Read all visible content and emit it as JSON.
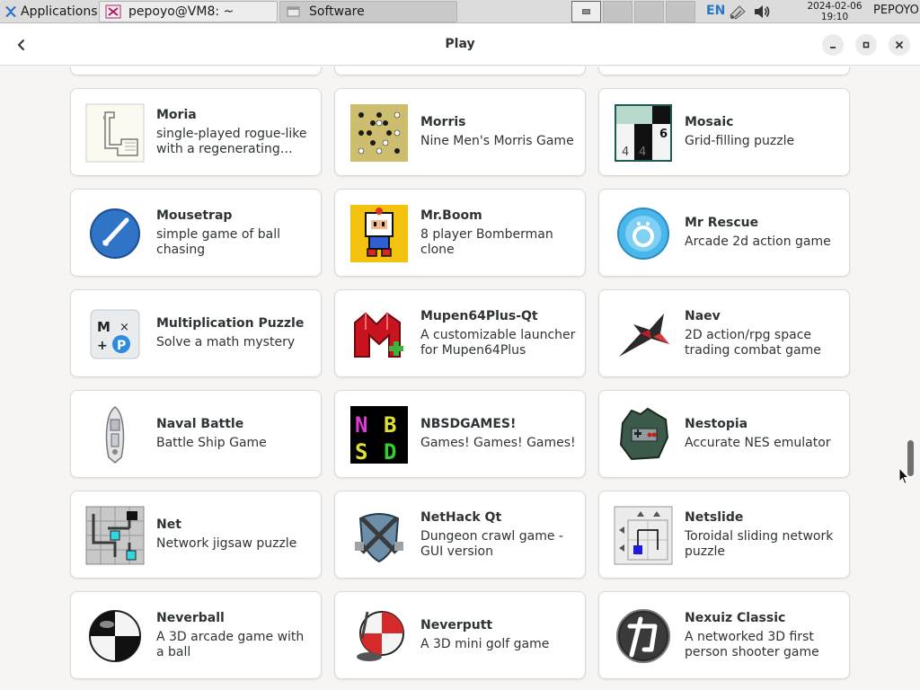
{
  "taskbar": {
    "apps_menu_label": "Applications",
    "tasks": [
      {
        "label": "pepoyo@VM8: ~"
      },
      {
        "label": "Software"
      }
    ],
    "language": "EN",
    "clock_date": "2024-02-06",
    "clock_time": "19:10",
    "user": "PEPOYO"
  },
  "header": {
    "title": "Play"
  },
  "apps": [
    {
      "name": "Moria",
      "description": "single-played rogue-like with a regenerating dungeon",
      "icon": "moria-map-icon"
    },
    {
      "name": "Morris",
      "description": "Nine Men's Morris Game",
      "icon": "morris-board-icon"
    },
    {
      "name": "Mosaic",
      "description": "Grid-filling puzzle",
      "icon": "mosaic-grid-icon"
    },
    {
      "name": "Mousetrap",
      "description": "simple game of ball chasing",
      "icon": "mousetrap-icon"
    },
    {
      "name": "Mr.Boom",
      "description": "8 player Bomberman clone",
      "icon": "mrboom-icon"
    },
    {
      "name": "Mr Rescue",
      "description": "Arcade 2d action game",
      "icon": "mr-rescue-icon"
    },
    {
      "name": "Multiplication Puzzle",
      "description": "Solve a math mystery",
      "icon": "multiplication-puzzle-icon"
    },
    {
      "name": "Mupen64Plus-Qt",
      "description": "A customizable launcher for Mupen64Plus",
      "icon": "mupen64plus-icon"
    },
    {
      "name": "Naev",
      "description": "2D action/rpg space trading combat game",
      "icon": "naev-ship-icon"
    },
    {
      "name": "Naval Battle",
      "description": "Battle Ship Game",
      "icon": "naval-battle-ship-icon"
    },
    {
      "name": "NBSDGAMES!",
      "description": "Games! Games! Games!",
      "icon": "nbsdgames-icon"
    },
    {
      "name": "Nestopia",
      "description": "Accurate NES emulator",
      "icon": "nestopia-icon"
    },
    {
      "name": "Net",
      "description": "Network jigsaw puzzle",
      "icon": "net-puzzle-icon"
    },
    {
      "name": "NetHack Qt",
      "description": "Dungeon crawl game - GUI version",
      "icon": "nethack-shield-icon"
    },
    {
      "name": "Netslide",
      "description": "Toroidal sliding network puzzle",
      "icon": "netslide-icon"
    },
    {
      "name": "Neverball",
      "description": "A 3D arcade game with a ball",
      "icon": "neverball-icon"
    },
    {
      "name": "Neverputt",
      "description": "A 3D mini golf game",
      "icon": "neverputt-icon"
    },
    {
      "name": "Nexuiz Classic",
      "description": "A networked 3D first person shooter game",
      "icon": "nexuiz-icon"
    }
  ]
}
